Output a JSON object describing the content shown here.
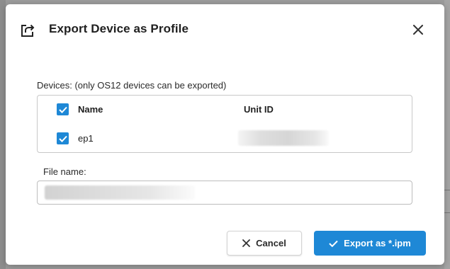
{
  "dialog": {
    "title": "Export Device as Profile",
    "title_icon": "export-icon",
    "close_icon": "close-icon"
  },
  "devices": {
    "label": "Devices: (only OS12 devices can be exported)",
    "columns": {
      "name": "Name",
      "unit_id": "Unit ID"
    },
    "header_checked": true,
    "rows": [
      {
        "name": "ep1",
        "unit_id": "",
        "checked": true
      }
    ]
  },
  "file": {
    "label": "File name:",
    "value": ""
  },
  "buttons": {
    "cancel": "Cancel",
    "cancel_icon": "close-icon",
    "export": "Export as *.ipm",
    "export_icon": "checkmark-icon"
  },
  "colors": {
    "accent": "#1e88d6",
    "backdrop": "#9c9c9c"
  }
}
